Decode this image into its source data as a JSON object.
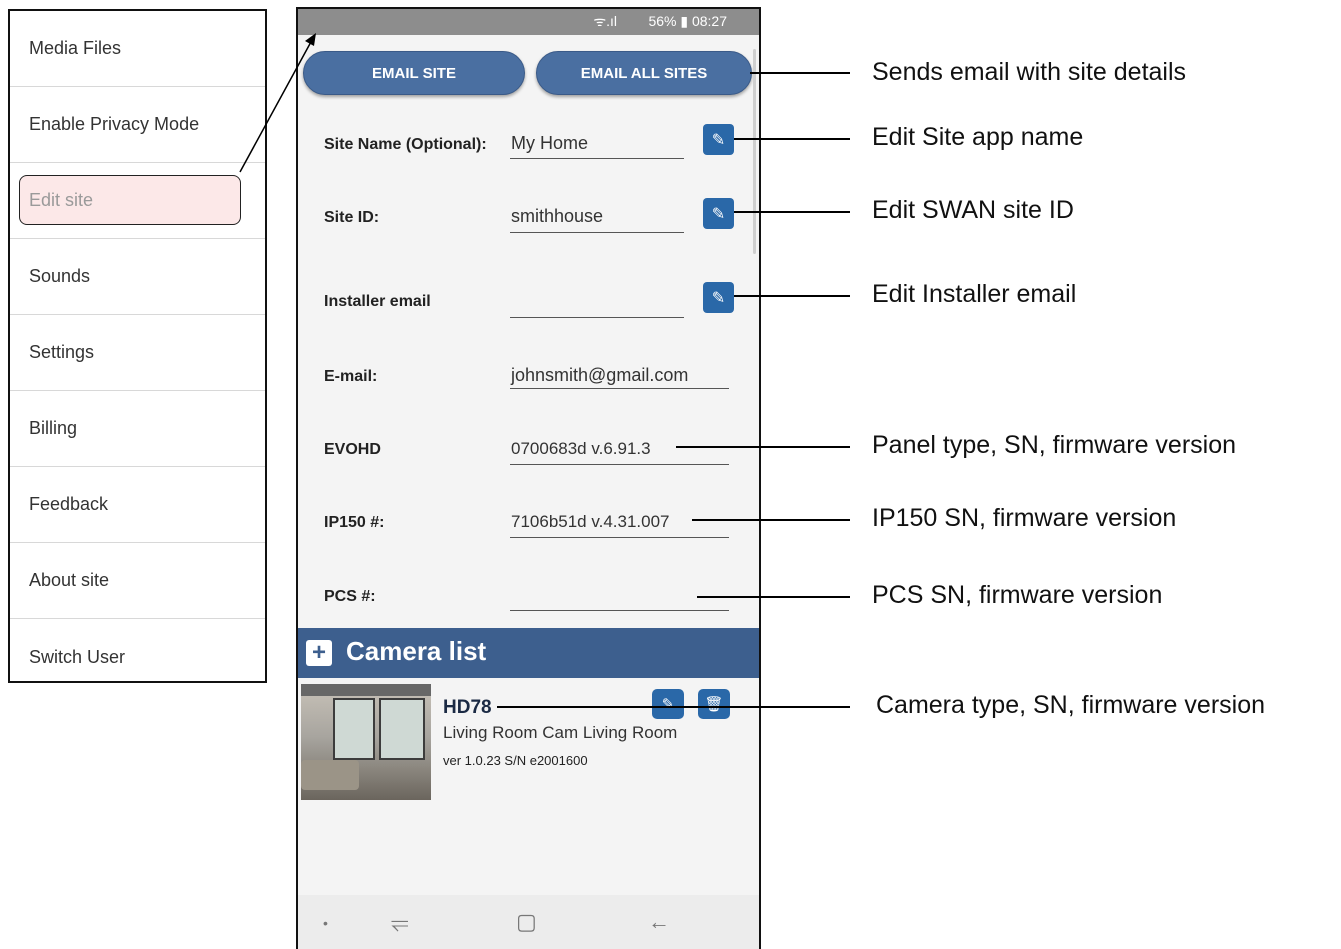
{
  "menu": {
    "items": [
      {
        "label": "Media Files"
      },
      {
        "label": "Enable Privacy Mode"
      },
      {
        "label": "Edit site"
      },
      {
        "label": "Sounds"
      },
      {
        "label": "Settings"
      },
      {
        "label": "Billing"
      },
      {
        "label": "Feedback"
      },
      {
        "label": "About site"
      },
      {
        "label": "Switch User"
      }
    ],
    "active_index": 2
  },
  "status_bar": {
    "text": "56% ▮ 08:27",
    "signal": "ᯤ.ıl"
  },
  "buttons": {
    "email_site": "EMAIL SITE",
    "email_all_sites": "EMAIL ALL SITES"
  },
  "form": {
    "site_name": {
      "label": "Site Name (Optional):",
      "value": "My Home"
    },
    "site_id": {
      "label": "Site ID:",
      "value": "smithhouse"
    },
    "installer_email": {
      "label": "Installer email",
      "value": ""
    },
    "email": {
      "label": "E-mail:",
      "value": "johnsmith@gmail.com"
    },
    "panel": {
      "label": "EVOHD",
      "value": "0700683d  v.6.91.3"
    },
    "ip150": {
      "label": "IP150 #:",
      "value": "7106b51d  v.4.31.007"
    },
    "pcs": {
      "label": "PCS #:",
      "value": ""
    }
  },
  "camera_list": {
    "title": "Camera list",
    "cameras": [
      {
        "type": "HD78",
        "name": "Living Room Cam Living Room",
        "version": "ver 1.0.23 S/N e2001600"
      }
    ]
  },
  "annotations": {
    "sends_email": "Sends email with site details",
    "edit_site_name": "Edit Site app name",
    "edit_site_id": "Edit SWAN site ID",
    "edit_installer": "Edit Installer email",
    "panel": "Panel type, SN, firmware version",
    "ip150": "IP150 SN, firmware version",
    "pcs": "PCS SN, firmware version",
    "camera": "Camera type, SN, firmware version"
  },
  "colors": {
    "accent": "#2a68a8",
    "header": "#3d5f8e",
    "highlight": "#fce8e8"
  },
  "icons": {
    "edit": "pencil-icon",
    "delete": "trash-icon",
    "add": "plus-icon"
  }
}
